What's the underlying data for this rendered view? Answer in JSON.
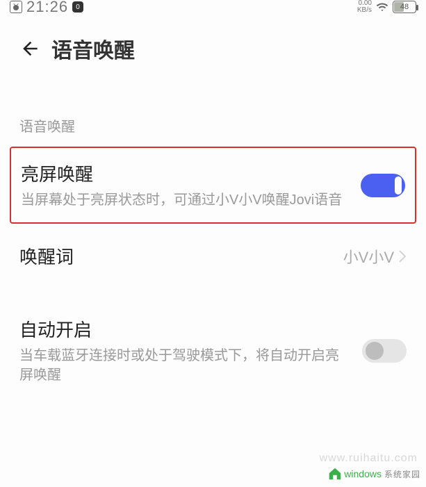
{
  "status": {
    "time": "21:26",
    "badge": "0",
    "net_rate_top": "0.00",
    "net_rate_unit": "KB/s",
    "battery": "48"
  },
  "header": {
    "title": "语音唤醒"
  },
  "section_label": "语音唤醒",
  "rows": {
    "screen_wake": {
      "title": "亮屏唤醒",
      "desc": "当屏幕处于亮屏状态时，可通过小V小V唤醒Jovi语音",
      "toggle": "on"
    },
    "wake_word": {
      "title": "唤醒词",
      "value": "小V小V"
    },
    "auto_on": {
      "title": "自动开启",
      "desc": "当车载蓝牙连接时或处于驾驶模式下，将自动开启亮屏唤醒",
      "toggle": "off"
    }
  },
  "watermark": {
    "brand": "windows",
    "cn": "系统家园",
    "url": "www.ruihaitu.com"
  }
}
